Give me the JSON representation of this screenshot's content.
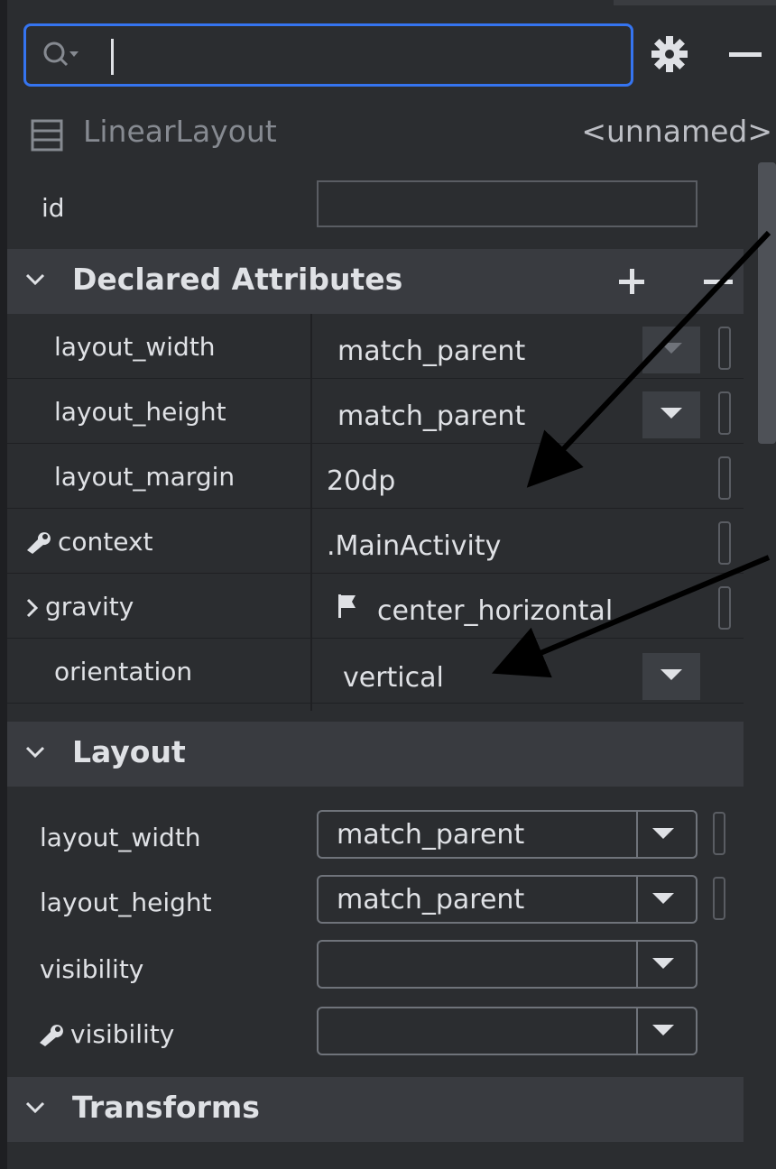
{
  "search": {
    "value": "",
    "placeholder": ""
  },
  "component": {
    "type": "LinearLayout",
    "name": "<unnamed>"
  },
  "id_row": {
    "label": "id",
    "value": ""
  },
  "declared": {
    "title": "Declared Attributes",
    "rows": [
      {
        "label": "layout_width",
        "value": "match_parent",
        "has_dropdown": true
      },
      {
        "label": "layout_height",
        "value": "match_parent",
        "has_dropdown": true
      },
      {
        "label": "layout_margin",
        "value": "20dp",
        "has_dropdown": false
      },
      {
        "label": "context",
        "value": ".MainActivity",
        "icon": "wrench-icon"
      },
      {
        "label": "gravity",
        "value": "center_horizontal",
        "icon": "flag-icon",
        "expandable": true
      },
      {
        "label": "orientation",
        "value": "vertical",
        "has_dropdown": true
      }
    ]
  },
  "layout": {
    "title": "Layout",
    "rows": [
      {
        "label": "layout_width",
        "value": "match_parent"
      },
      {
        "label": "layout_height",
        "value": "match_parent"
      },
      {
        "label": "visibility",
        "value": ""
      },
      {
        "label": "visibility",
        "value": "",
        "icon": "wrench-icon"
      }
    ]
  },
  "transforms": {
    "title": "Transforms"
  },
  "colors": {
    "accent": "#3574f0",
    "background": "#2b2d30",
    "section": "#393b40",
    "arrow": "#000000"
  }
}
